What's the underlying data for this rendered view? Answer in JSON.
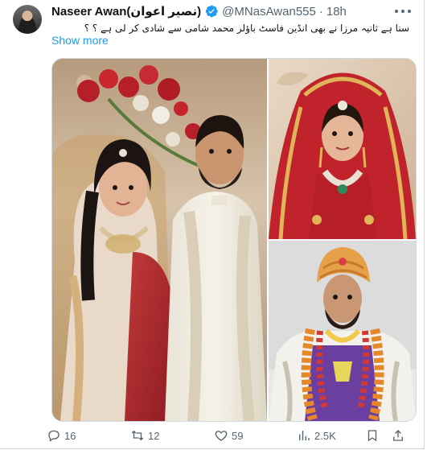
{
  "author": {
    "name": "Naseer Awan(نصیر اعوان)",
    "handle": "@MNasAwan555",
    "separator": "·",
    "time": "18h",
    "verified_icon": "verified-badge-icon"
  },
  "tweet": {
    "text": "سنا ہے ثانیہ مرزا نے بھی انڈین فاسٹ باؤلر محمد شامی سے شادی کر لی ہے ؟ ؟",
    "show_more_label": "Show more"
  },
  "media": {
    "images": [
      {
        "semantic": "wedding-couple-photo"
      },
      {
        "semantic": "bride-red-dress-photo"
      },
      {
        "semantic": "groom-turban-garland-photo"
      }
    ]
  },
  "actions": {
    "replies": "16",
    "reposts": "12",
    "likes": "59",
    "views": "2.5K"
  },
  "colors": {
    "accent": "#1d9bf0",
    "secondary_text": "#536471",
    "primary_text": "#0f1419",
    "border": "#cfd9de"
  }
}
